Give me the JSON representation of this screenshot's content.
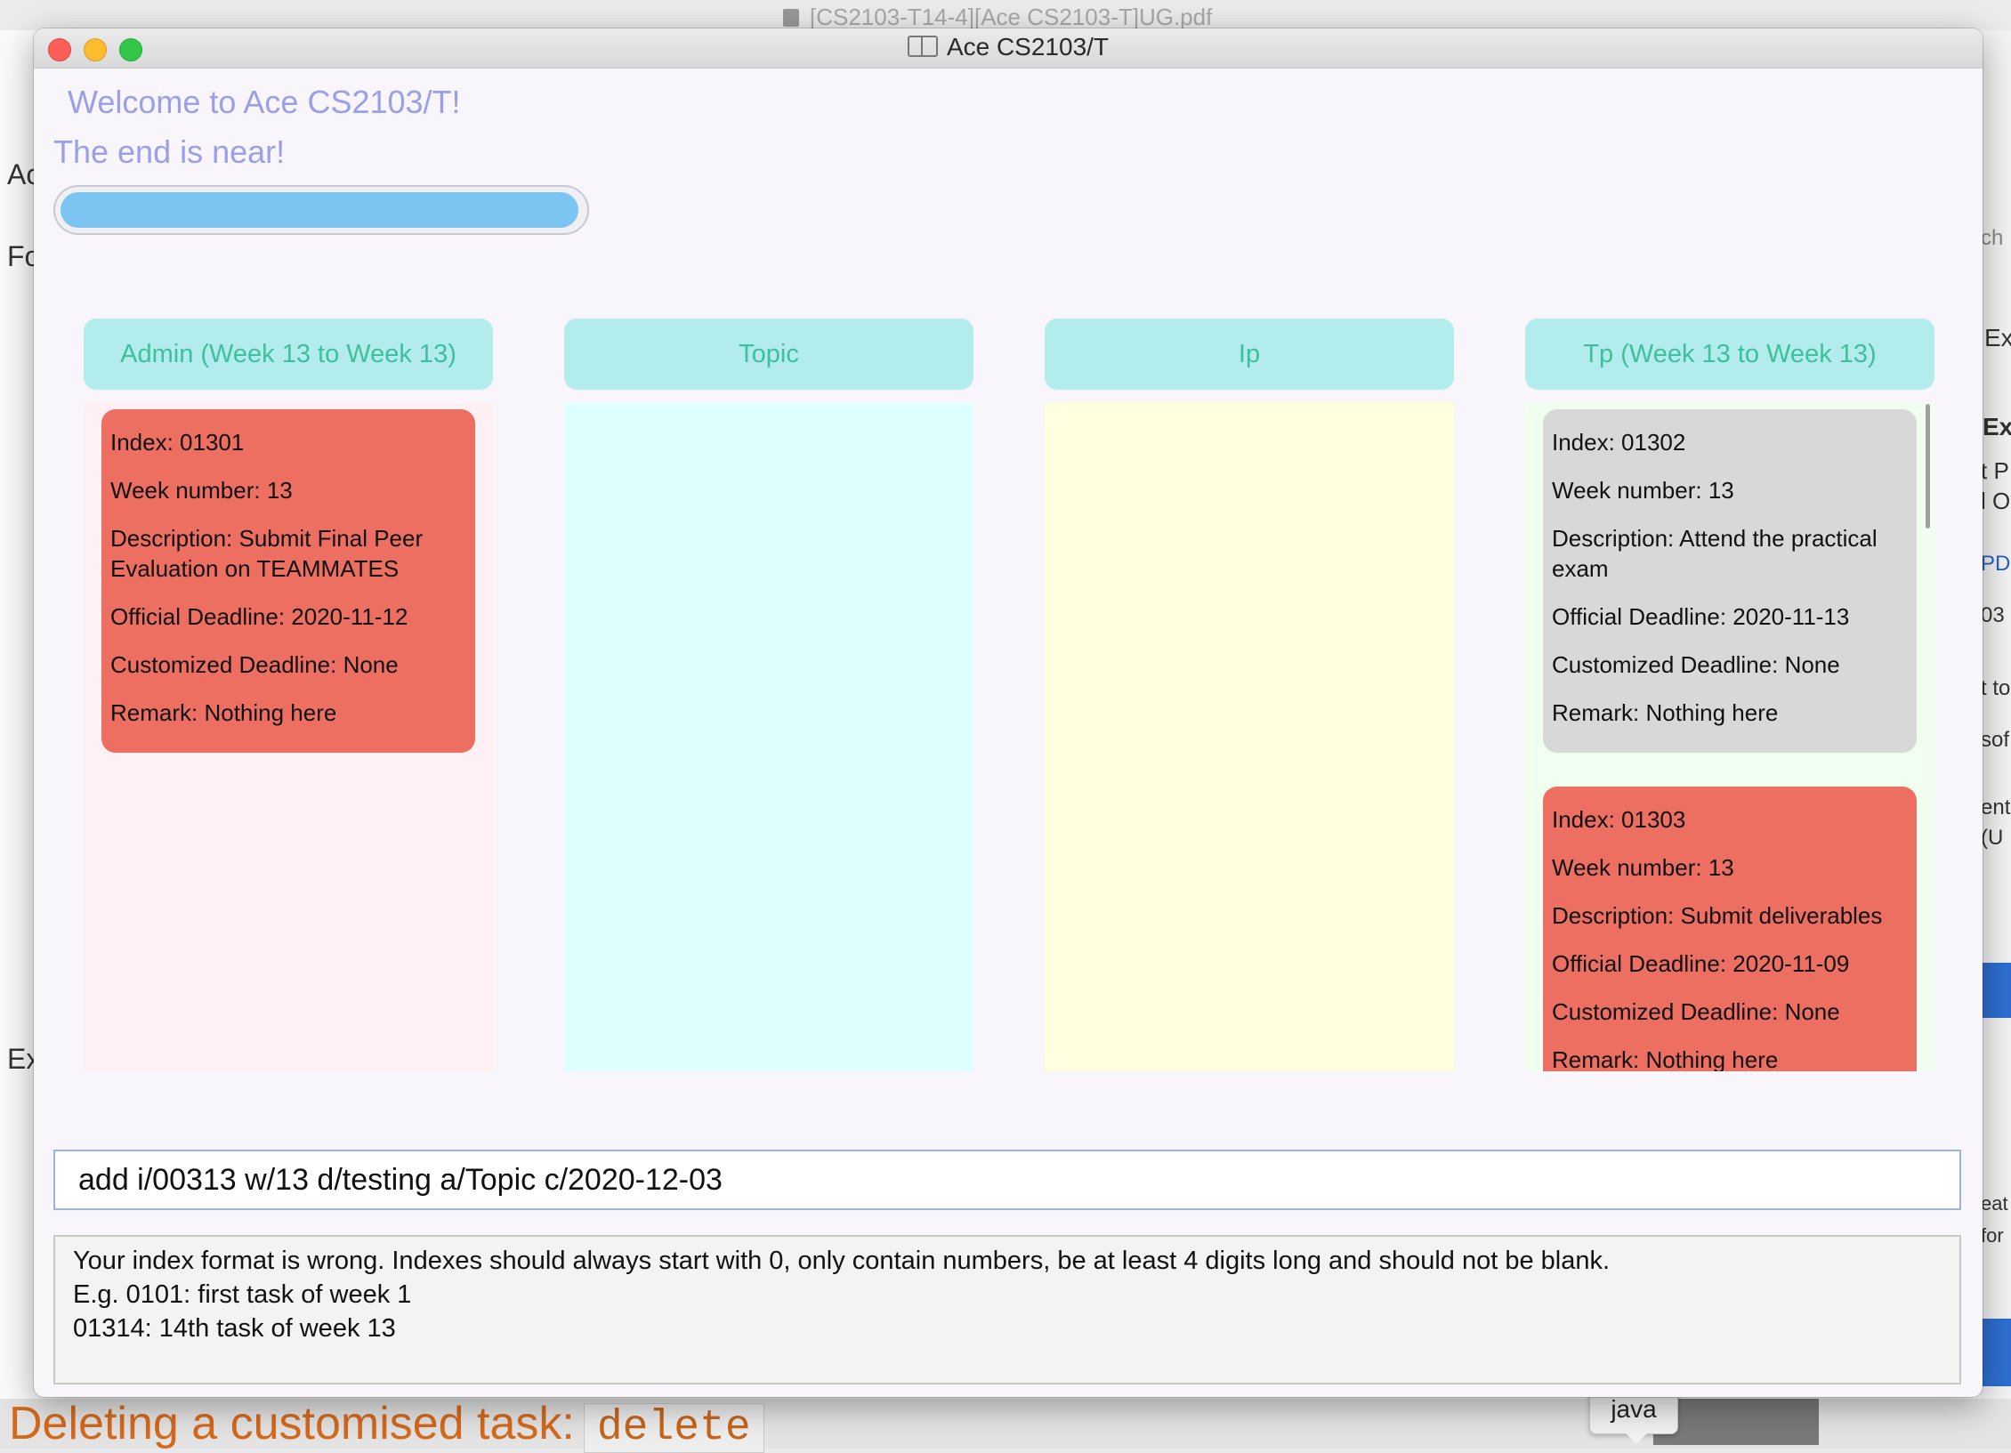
{
  "background": {
    "pdf_title": "[CS2103-T14-4][Ace CS2103-T]UG.pdf",
    "left_snippets": [
      "Ac",
      "Fo",
      "Ex"
    ],
    "right_snippets": [
      "ch",
      "Ex",
      "Ex",
      "t P",
      "l O",
      "PDI",
      "03",
      "t to",
      "sof",
      "ent",
      "(U",
      "eat",
      "for"
    ],
    "bottom_heading": "Deleting a customised task:",
    "bottom_code": "delete",
    "dock_tooltip": "java"
  },
  "window": {
    "title": "Ace CS2103/T",
    "welcome": "Welcome to Ace CS2103/T!",
    "subtitle": "The end is near!",
    "progress": 1.0
  },
  "columns": [
    {
      "header": "Admin (Week 13 to Week 13)",
      "bg_color": "#fff0f3",
      "cards": [
        {
          "color": "#ec6f62",
          "index": "Index: 01301",
          "week": "Week number: 13",
          "description": "Description: Submit Final Peer Evaluation on TEAMMATES",
          "official": "Official Deadline: 2020-11-12",
          "customized": "Customized Deadline: None",
          "remark": "Remark: Nothing here"
        }
      ]
    },
    {
      "header": "Topic",
      "bg_color": "#e0ffff",
      "cards": []
    },
    {
      "header": "Ip",
      "bg_color": "#fffede",
      "cards": []
    },
    {
      "header": "Tp (Week 13 to Week 13)",
      "bg_color": "#f1fff0",
      "cards": [
        {
          "color": "#d7d9d9",
          "index": "Index: 01302",
          "week": "Week number: 13",
          "description": "Description: Attend the practical exam",
          "official": "Official Deadline: 2020-11-13",
          "customized": "Customized Deadline: None",
          "remark": "Remark: Nothing here"
        },
        {
          "color": "#ec6f62",
          "index": "Index: 01303",
          "week": "Week number: 13",
          "description": "Description: Submit deliverables",
          "official": "Official Deadline: 2020-11-09",
          "customized": "Customized Deadline: None",
          "remark": "Remark: Nothing here"
        }
      ]
    }
  ],
  "command_input": {
    "value": "add i/00313 w/13 d/testing a/Topic c/2020-12-03"
  },
  "result_display": {
    "lines": [
      "Your index format is wrong. Indexes should always start with 0, only contain numbers, be at least 4 digits long and should not be blank.",
      "E.g. 0101: first task of week 1",
      "01314: 14th task of week 13"
    ]
  }
}
